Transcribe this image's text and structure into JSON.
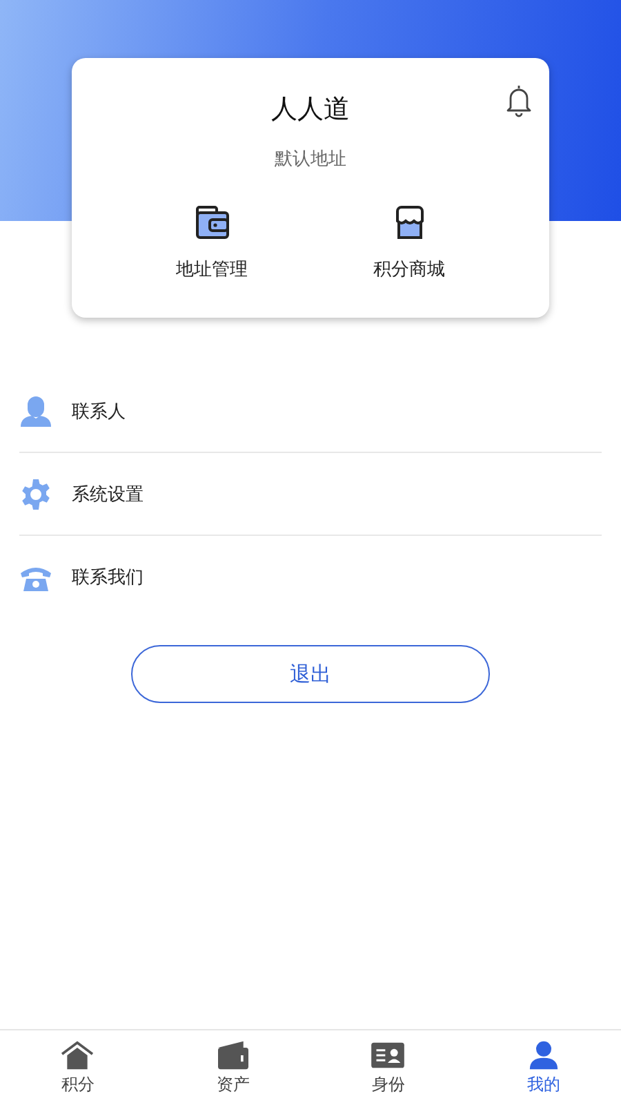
{
  "profile_card": {
    "name": "人人道",
    "address": "默认地址",
    "shortcuts": [
      {
        "label": "地址管理"
      },
      {
        "label": "积分商城"
      }
    ]
  },
  "menu": [
    {
      "label": "联系人"
    },
    {
      "label": "系统设置"
    },
    {
      "label": "联系我们"
    }
  ],
  "logout_button": "退出",
  "tab_bar": [
    {
      "label": "积分",
      "selected": false
    },
    {
      "label": "资产",
      "selected": false
    },
    {
      "label": "身份",
      "selected": false
    },
    {
      "label": "我的",
      "selected": true
    }
  ]
}
